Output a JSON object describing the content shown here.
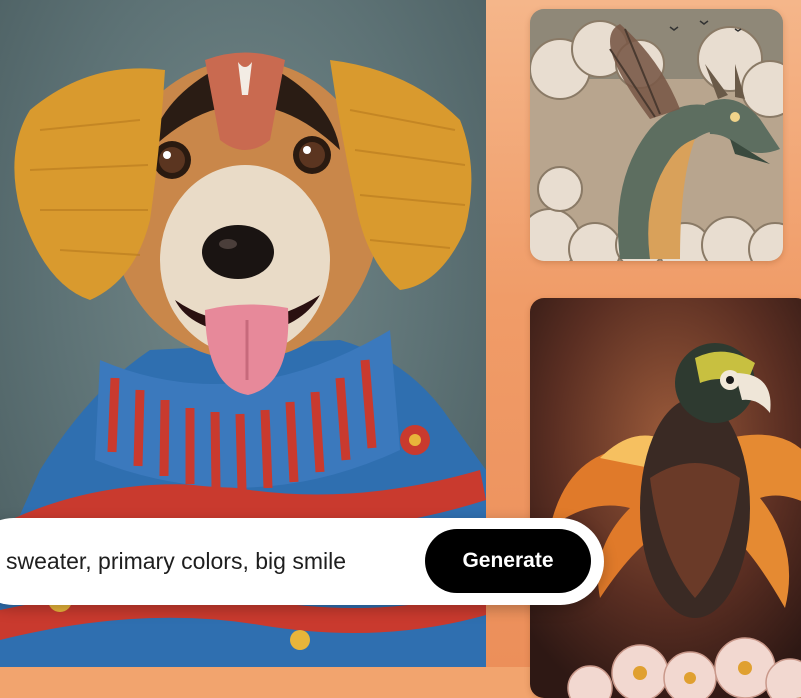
{
  "prompt": {
    "text": "sweater, primary colors, big smile"
  },
  "actions": {
    "generate_label": "Generate"
  },
  "colors": {
    "right_panel_bg": "#f09c68",
    "generate_button_bg": "#000000",
    "prompt_bar_bg": "#ffffff"
  },
  "images": [
    {
      "subject": "dog wearing knitted hat and sweater"
    },
    {
      "subject": "dragon in clouds"
    },
    {
      "subject": "parrot with fiery feathers"
    }
  ]
}
